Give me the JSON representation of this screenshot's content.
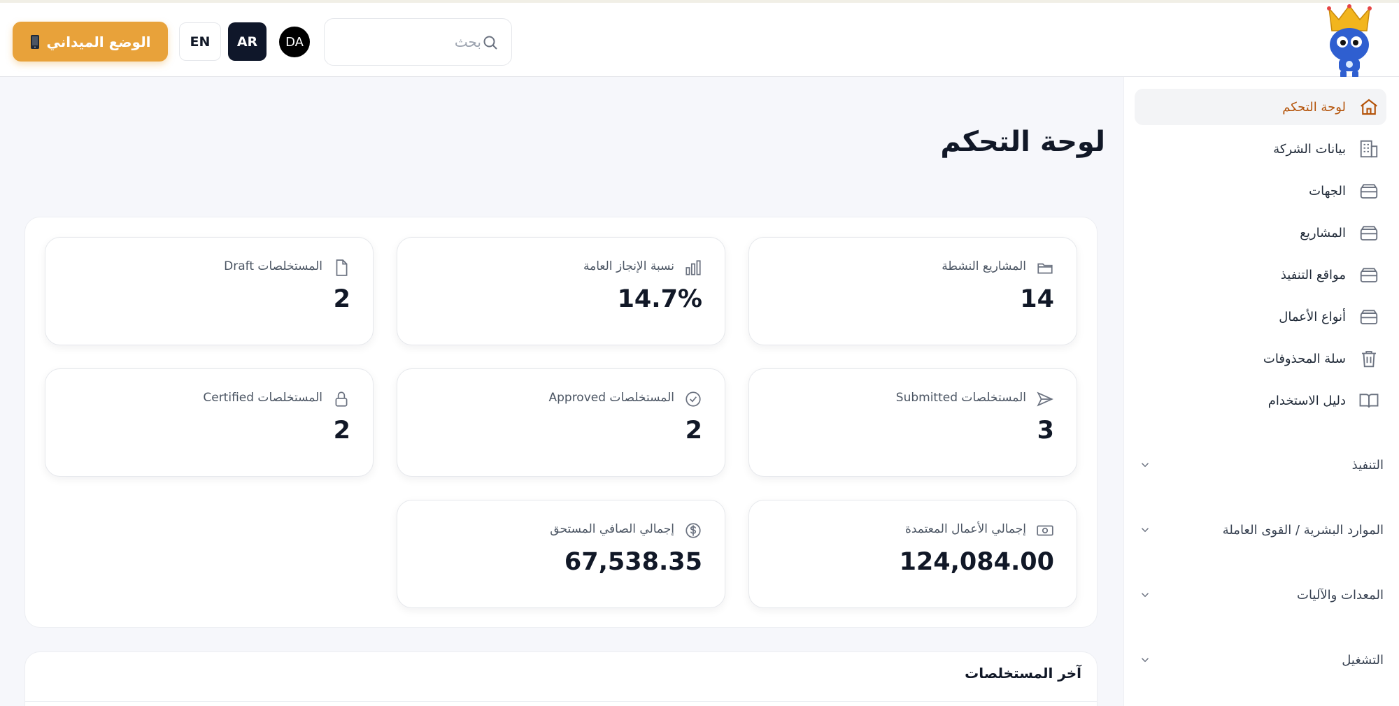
{
  "header": {
    "field_mode_label": "الوضع الميداني",
    "field_mode_icon": "phone-icon",
    "lang_en": "EN",
    "lang_ar": "AR",
    "avatar_initials": "DA",
    "search_placeholder": "بحث",
    "search_value": ""
  },
  "sidebar": {
    "items": [
      {
        "label": "لوحة التحكم",
        "icon": "home-icon",
        "active": true
      },
      {
        "label": "بيانات الشركة",
        "icon": "building-icon"
      },
      {
        "label": "الجهات",
        "icon": "box-icon"
      },
      {
        "label": "المشاريع",
        "icon": "box-icon"
      },
      {
        "label": "مواقع التنفيذ",
        "icon": "box-icon"
      },
      {
        "label": "أنواع الأعمال",
        "icon": "box-icon"
      },
      {
        "label": "سلة المحذوفات",
        "icon": "trash-icon"
      },
      {
        "label": "دليل الاستخدام",
        "icon": "book-icon"
      }
    ],
    "sections": [
      {
        "label": "التنفيذ"
      },
      {
        "label": "الموارد البشرية / القوى العاملة"
      },
      {
        "label": "المعدات والآليات"
      },
      {
        "label": "التشغيل"
      }
    ]
  },
  "main": {
    "title": "لوحة التحكم",
    "cards": [
      {
        "label": "المشاريع النشطة",
        "value": "14",
        "icon": "folder-icon"
      },
      {
        "label": "نسبة الإنجاز العامة",
        "value": "14.7%",
        "icon": "bar-chart-icon"
      },
      {
        "label": "المستخلصات Draft",
        "value": "2",
        "icon": "file-icon"
      },
      {
        "label": "المستخلصات Submitted",
        "value": "3",
        "icon": "send-icon"
      },
      {
        "label": "المستخلصات Approved",
        "value": "2",
        "icon": "check-circle-icon"
      },
      {
        "label": "المستخلصات Certified",
        "value": "2",
        "icon": "lock-icon"
      },
      {
        "label": "إجمالي الأعمال المعتمدة",
        "value": "124,084.00",
        "icon": "banknote-icon"
      },
      {
        "label": "إجمالي الصافي المستحق",
        "value": "67,538.35",
        "icon": "dollar-circle-icon"
      }
    ],
    "recent_title": "آخر المستخلصات"
  },
  "colors": {
    "accent": "#e8a23a",
    "active_nav": "#b45309",
    "dark": "#0f172a",
    "background": "#f6f7fb"
  }
}
